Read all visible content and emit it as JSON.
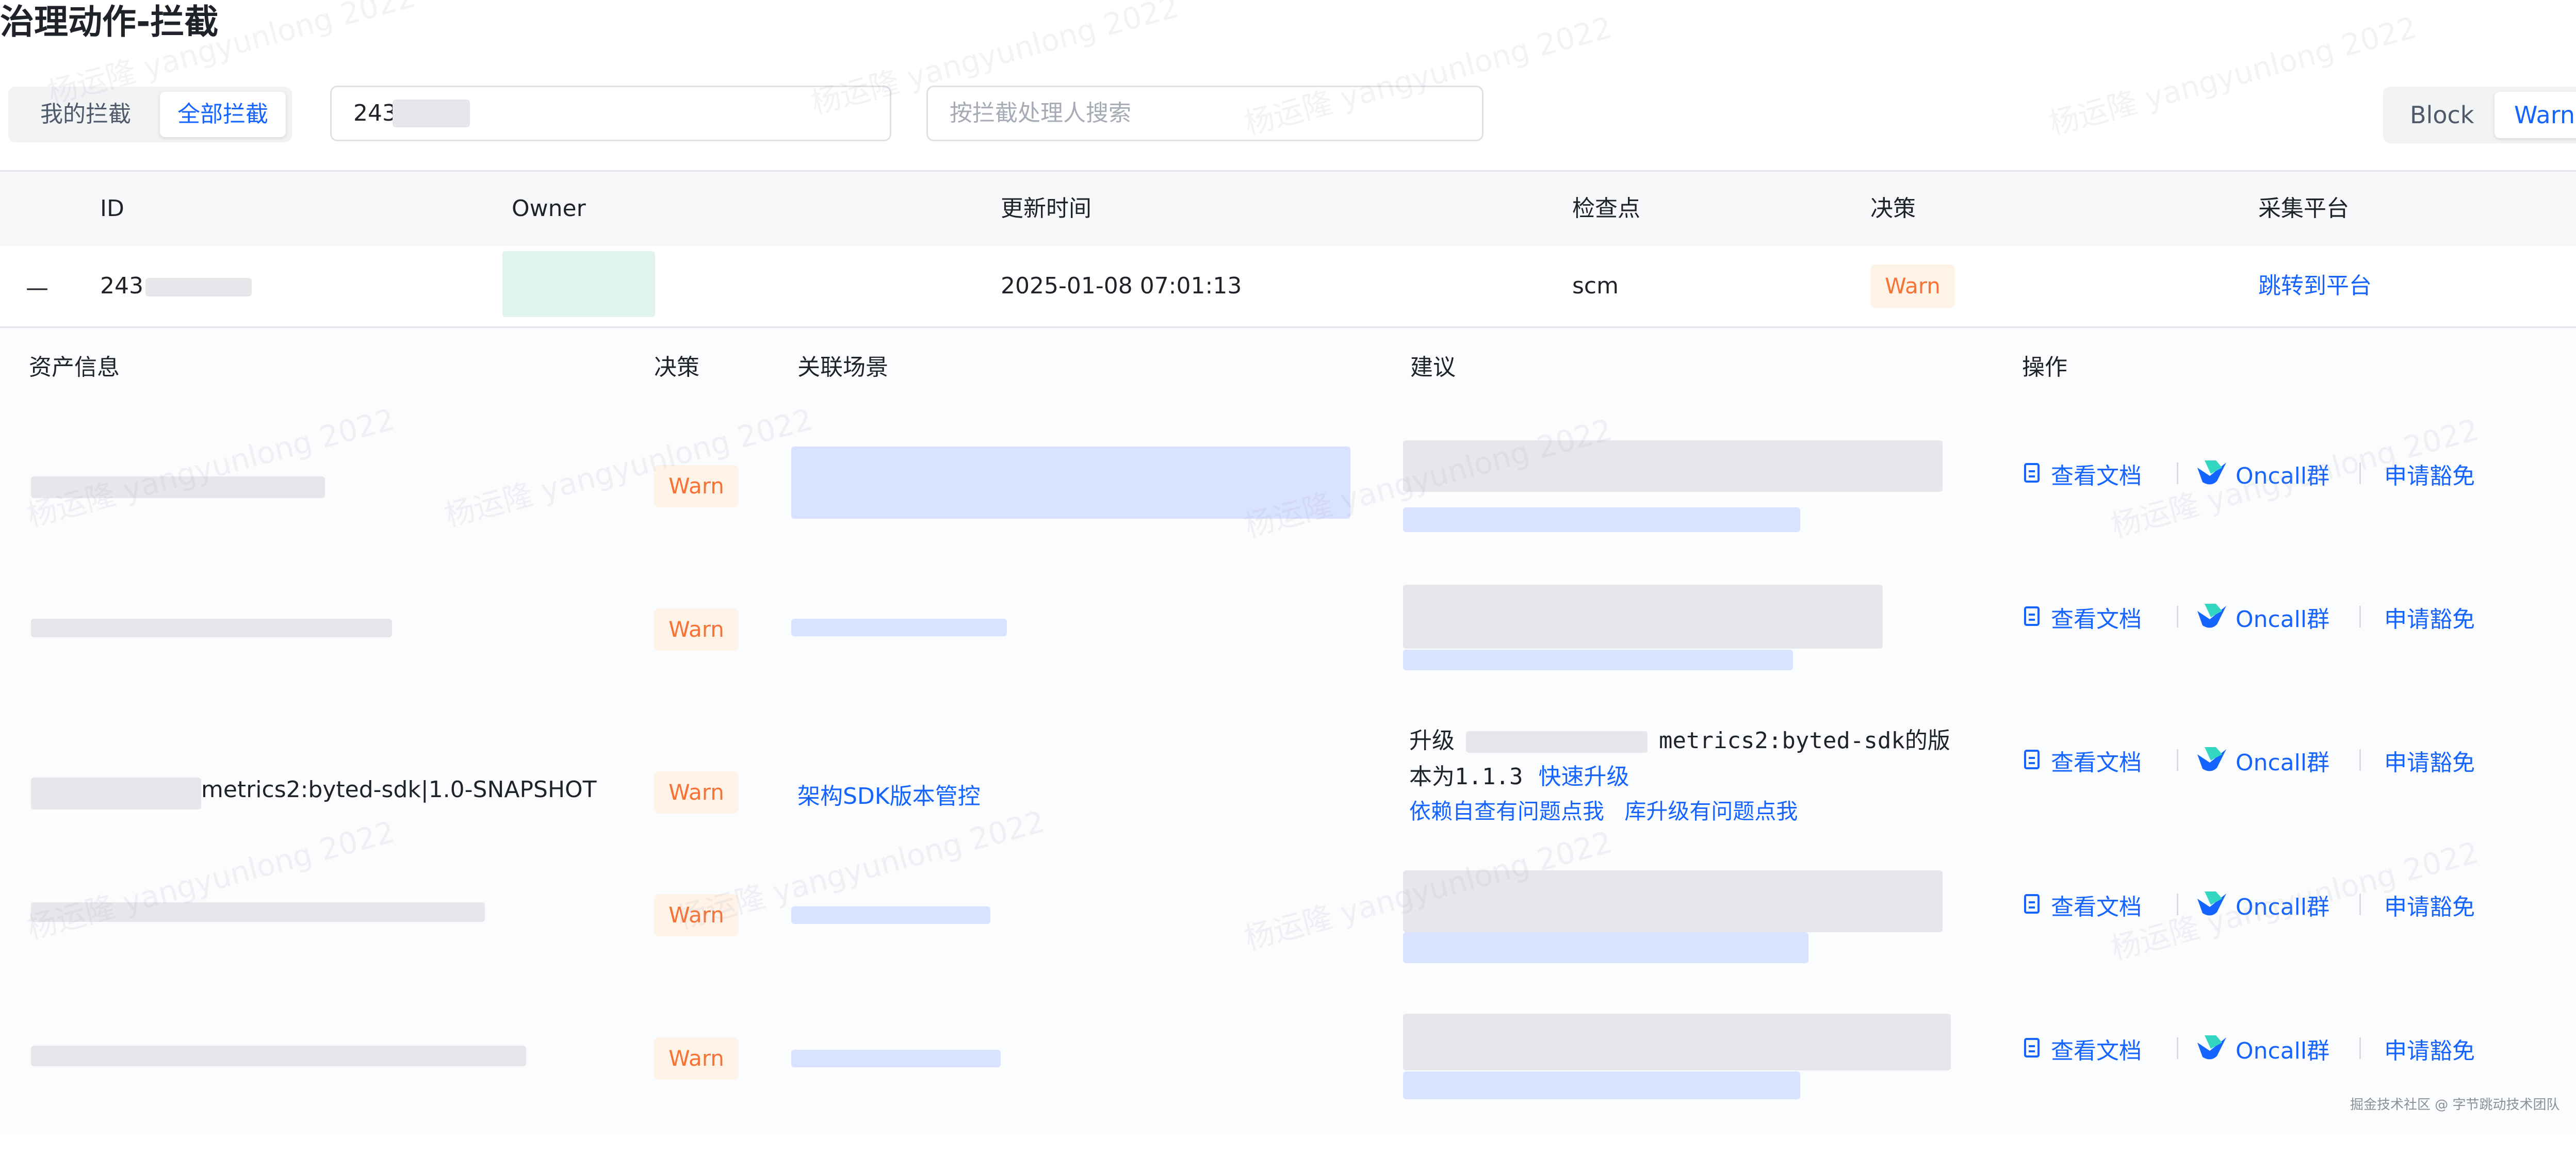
{
  "page": {
    "title": "治理动作-拦截"
  },
  "scope_tabs": [
    {
      "label": "我的拦截",
      "active": false
    },
    {
      "label": "全部拦截",
      "active": true
    }
  ],
  "filters": {
    "id_value": "243",
    "handler_placeholder": "按拦截处理人搜索"
  },
  "view_toggle": [
    {
      "label": "Block",
      "active": false
    },
    {
      "label": "Warn",
      "active": true
    }
  ],
  "main_table": {
    "columns": [
      "ID",
      "Owner",
      "更新时间",
      "检查点",
      "决策",
      "采集平台"
    ],
    "row": {
      "collapse_symbol": "—",
      "id": "243",
      "updated_at": "2025-01-08 07:01:13",
      "checkpoint": "scm",
      "decision": "Warn",
      "platform_link": "跳转到平台"
    }
  },
  "sub_table": {
    "columns": [
      "资产信息",
      "决策",
      "关联场景",
      "建议",
      "操作"
    ],
    "rows": [
      {
        "asset": "",
        "decision": "Warn",
        "scene": "",
        "suggestion": ""
      },
      {
        "asset": "",
        "decision": "Warn",
        "scene": "",
        "suggestion": ""
      },
      {
        "asset": "metrics2:byted-sdk|1.0-SNAPSHOT",
        "decision": "Warn",
        "scene": "架构SDK版本管控",
        "suggestion": {
          "prefix": "升级",
          "target": "metrics2:byted-sdk的版",
          "line2": "本为1.1.3",
          "quick_upgrade": "快速升级",
          "help_self": "依赖自查有问题点我",
          "help_lib": "库升级有问题点我"
        }
      },
      {
        "asset": "",
        "decision": "Warn",
        "scene": "",
        "suggestion": ""
      },
      {
        "asset": "",
        "decision": "Warn",
        "scene": "",
        "suggestion": ""
      }
    ],
    "actions": {
      "doc": "查看文档",
      "oncall": "Oncall群",
      "exempt": "申请豁免"
    }
  },
  "watermark": {
    "text": "杨运隆 yangyunlong 2022"
  },
  "footer": {
    "text": "掘金技术社区 @ 字节跳动技术团队"
  },
  "colors": {
    "accent": "#1664ff",
    "warn_text": "#f77234",
    "warn_bg": "#fff3e8",
    "header_bg": "#f7f8fa"
  },
  "icons": {
    "doc": "document-icon",
    "oncall": "feishu-bird-icon"
  }
}
